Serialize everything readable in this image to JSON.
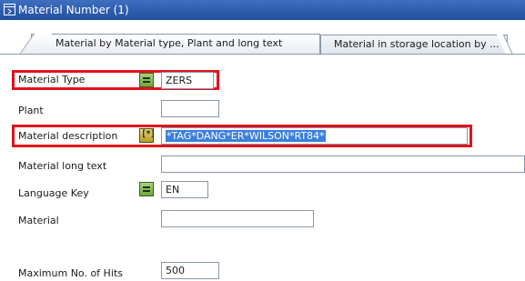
{
  "window": {
    "title": "Material Number (1)"
  },
  "tabs": [
    {
      "label": "Material by Material type, Plant and long text",
      "active": true
    },
    {
      "label": "Material in storage location by ...",
      "active": false
    }
  ],
  "form": {
    "material_type": {
      "label": "Material Type",
      "value": "ZERS"
    },
    "plant": {
      "label": "Plant",
      "value": ""
    },
    "material_description": {
      "label": "Material description",
      "value": "*TAG*DANG*ER*WILSON*RT84*"
    },
    "material_long_text": {
      "label": "Material long text",
      "value": ""
    },
    "language_key": {
      "label": "Language Key",
      "value": "EN"
    },
    "material": {
      "label": "Material",
      "value": ""
    },
    "max_hits": {
      "label": "Maximum No. of Hits",
      "value": "500"
    }
  },
  "colors": {
    "title_bar": "#2c5aa8",
    "highlight": "#e2131b",
    "selection": "#3c7fdc"
  },
  "icons": {
    "title_icon": "dialog-icon",
    "equal_option": "equal-option-icon",
    "pattern_option": "pattern-option-icon"
  }
}
